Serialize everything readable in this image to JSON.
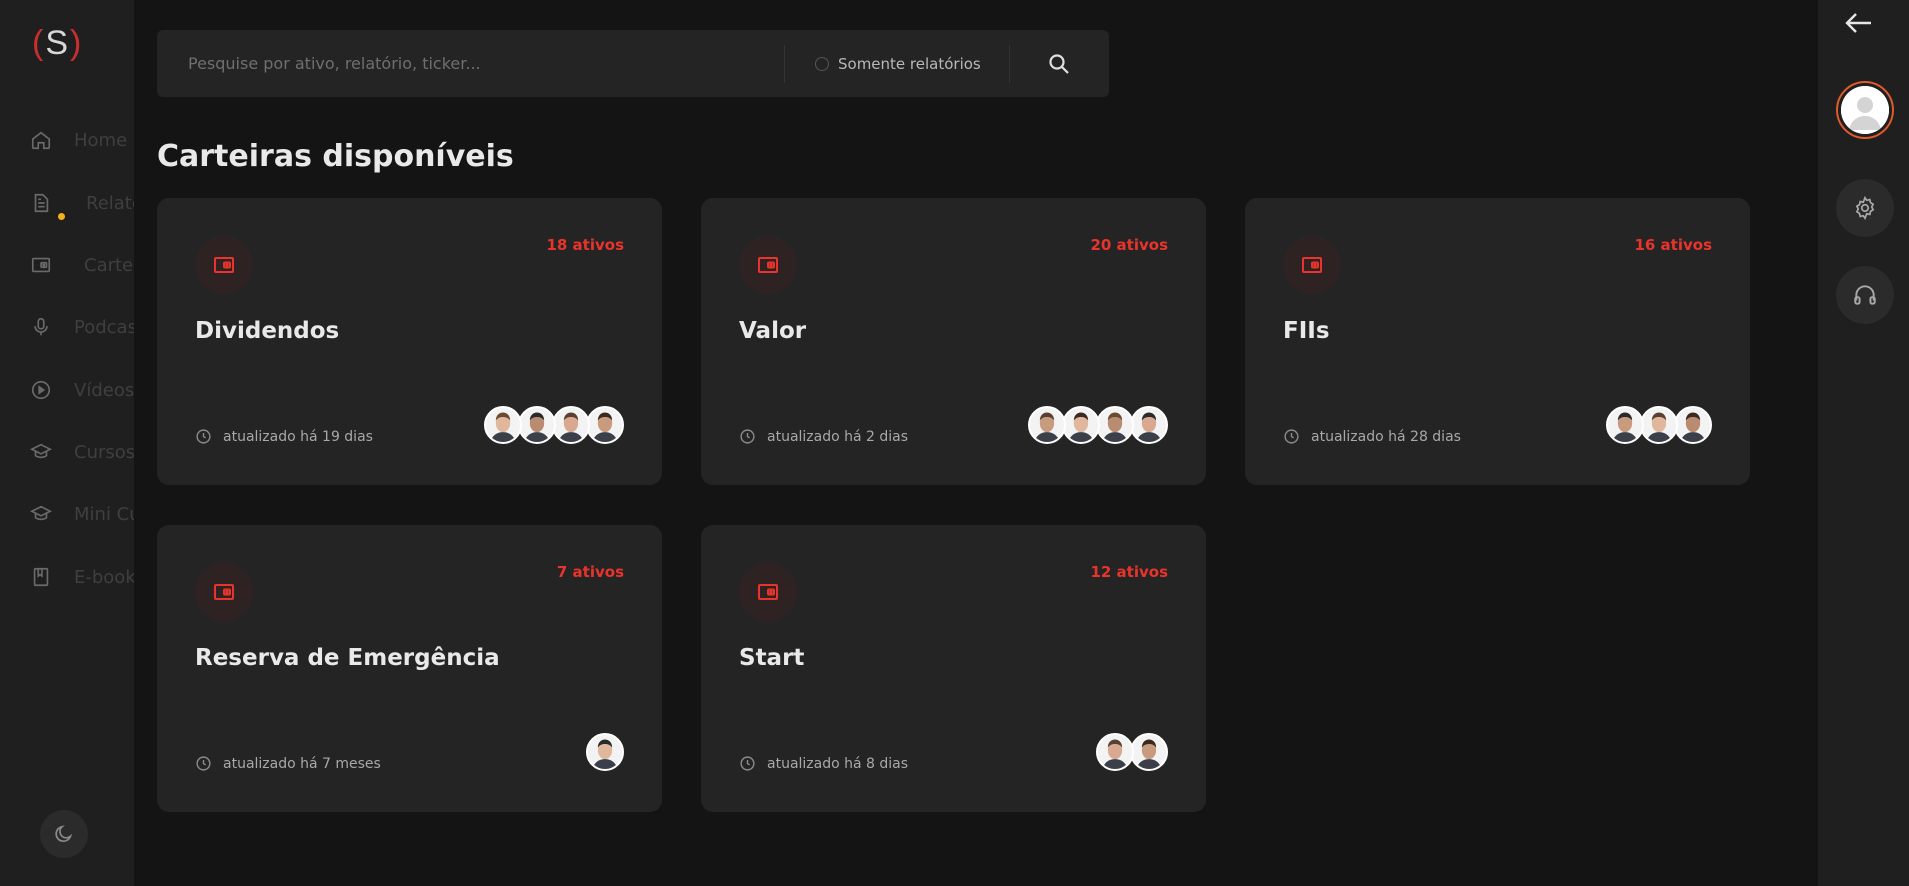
{
  "brand": {
    "logo_left": "(",
    "logo_mid": "S",
    "logo_right": ")"
  },
  "sidebar": {
    "items": [
      {
        "label": "Home",
        "icon": "home-icon"
      },
      {
        "label": "Relatórios",
        "icon": "document-icon"
      },
      {
        "label": "Carteiras",
        "icon": "wallet-icon"
      },
      {
        "label": "Podcasts",
        "icon": "microphone-icon"
      },
      {
        "label": "Vídeos",
        "icon": "play-icon"
      },
      {
        "label": "Cursos",
        "icon": "graduation-cap-icon"
      },
      {
        "label": "Mini Cursos",
        "icon": "graduation-cap-icon"
      },
      {
        "label": "E-books",
        "icon": "book-icon"
      }
    ]
  },
  "search": {
    "placeholder": "Pesquise por ativo, relatório, ticker...",
    "only_reports_label": "Somente relatórios"
  },
  "page": {
    "title": "Carteiras disponíveis"
  },
  "portfolios": [
    {
      "name": "Dividendos",
      "count": "18 ativos",
      "updated": "atualizado há 19 dias",
      "analysts": 4
    },
    {
      "name": "Valor",
      "count": "20 ativos",
      "updated": "atualizado há 2 dias",
      "analysts": 4
    },
    {
      "name": "FIIs",
      "count": "16 ativos",
      "updated": "atualizado há 28 dias",
      "analysts": 3
    },
    {
      "name": "Reserva de Emergência",
      "count": "7 ativos",
      "updated": "atualizado há 7 meses",
      "analysts": 1
    },
    {
      "name": "Start",
      "count": "12 ativos",
      "updated": "atualizado há 8 dias",
      "analysts": 2
    }
  ],
  "colors": {
    "accent": "#e8342c",
    "notification": "#f2b21c",
    "avatar_ring": "#e05a2a"
  }
}
